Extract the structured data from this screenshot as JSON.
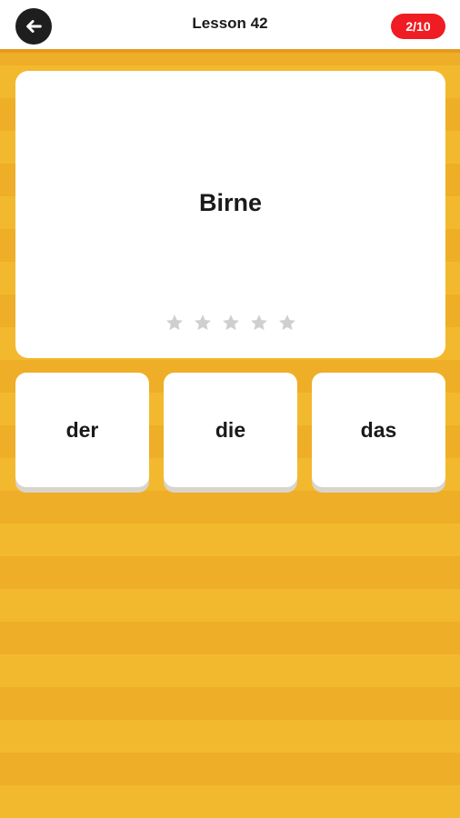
{
  "header": {
    "back_icon": "arrow-left-icon",
    "title": "Lesson 42",
    "progress": "2/10"
  },
  "card": {
    "word": "Birne",
    "stars": {
      "filled": 0,
      "total": 5
    }
  },
  "answers": [
    {
      "label": "der"
    },
    {
      "label": "die"
    },
    {
      "label": "das"
    }
  ],
  "colors": {
    "background": "#f0b12a",
    "header_border": "#e79a1e",
    "badge": "#ef1c24",
    "back_button": "#1e1e1e",
    "star_empty": "#cfcfcf"
  }
}
